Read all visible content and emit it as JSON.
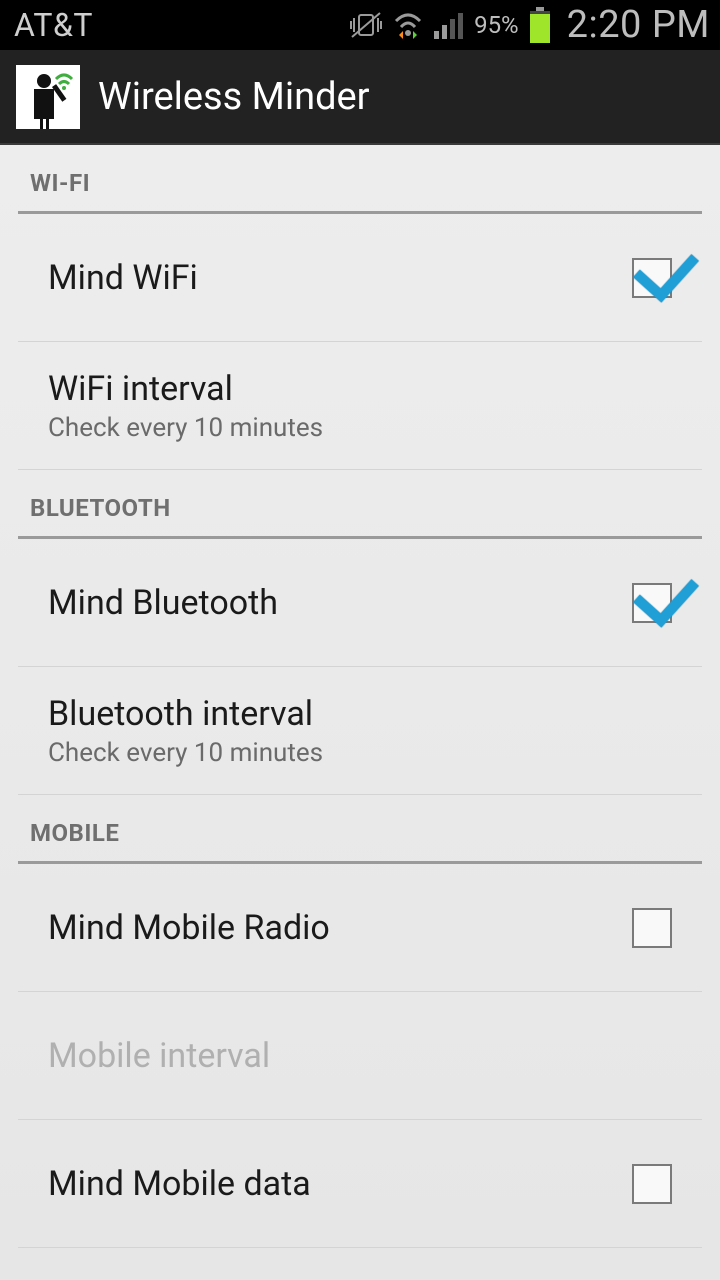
{
  "status": {
    "carrier": "AT&T",
    "battery_pct": "95%",
    "time": "2:20 PM"
  },
  "app": {
    "title": "Wireless Minder"
  },
  "sections": {
    "wifi": {
      "header": "WI-FI",
      "mind_label": "Mind WiFi",
      "mind_checked": true,
      "interval_title": "WiFi interval",
      "interval_summary": "Check every 10 minutes"
    },
    "bluetooth": {
      "header": "BLUETOOTH",
      "mind_label": "Mind Bluetooth",
      "mind_checked": true,
      "interval_title": "Bluetooth interval",
      "interval_summary": "Check every 10 minutes"
    },
    "mobile": {
      "header": "MOBILE",
      "mind_radio_label": "Mind Mobile Radio",
      "mind_radio_checked": false,
      "interval_title": "Mobile interval",
      "interval_enabled": false,
      "mind_data_label": "Mind Mobile data",
      "mind_data_checked": false
    }
  }
}
